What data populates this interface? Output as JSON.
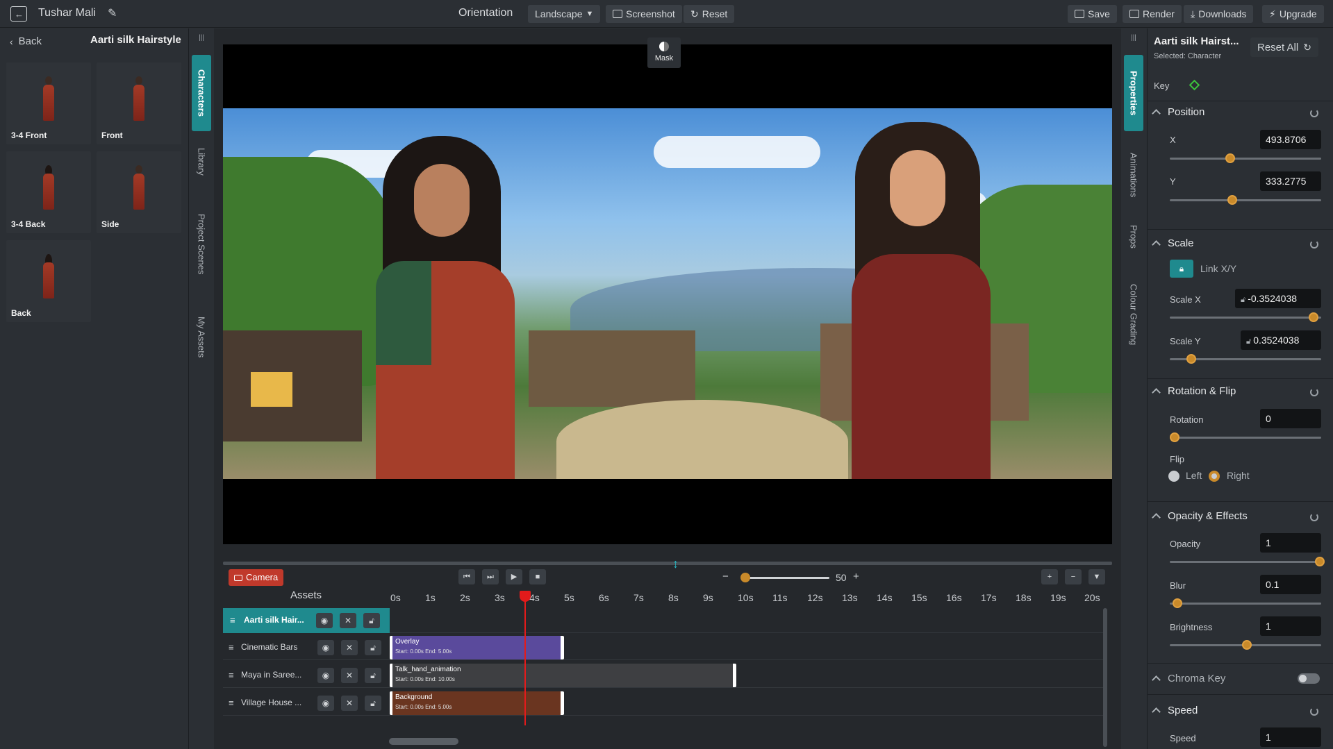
{
  "topbar": {
    "user_name": "Tushar Mali",
    "orientation_label": "Orientation",
    "orientation_value": "Landscape",
    "screenshot_label": "Screenshot",
    "reset_label": "Reset",
    "save_label": "Save",
    "render_label": "Render",
    "downloads_label": "Downloads",
    "upgrade_label": "Upgrade"
  },
  "leftpanel": {
    "back_label": "Back",
    "title": "Aarti silk Hairstyle",
    "thumbnails": [
      "3-4 Front",
      "Front",
      "3-4 Back",
      "Side",
      "Back"
    ]
  },
  "lefttabs": [
    "Characters",
    "Library",
    "Project Scenes",
    "My Assets"
  ],
  "righttabs": [
    "Properties",
    "Animations",
    "Props",
    "Colour Grading"
  ],
  "canvas": {
    "mask_label": "Mask"
  },
  "timeline": {
    "camera_label": "Camera",
    "assets_label": "Assets",
    "zoom_value": "50",
    "ticks": [
      "0s",
      "1s",
      "2s",
      "3s",
      "4s",
      "5s",
      "6s",
      "7s",
      "8s",
      "9s",
      "10s",
      "11s",
      "12s",
      "13s",
      "14s",
      "15s",
      "16s",
      "17s",
      "18s",
      "19s",
      "20s"
    ],
    "tracks": [
      {
        "name": "Aarti silk Hair...",
        "selected": true
      },
      {
        "name": "Cinematic Bars",
        "clip_title": "Overlay",
        "clip_sub": "Start: 0.00s   End: 5.00s"
      },
      {
        "name": "Maya in Saree...",
        "clip_title": "Talk_hand_animation",
        "clip_sub": "Start: 0.00s   End: 10.00s"
      },
      {
        "name": "Village House ...",
        "clip_title": "Background",
        "clip_sub": "Start: 0.00s   End: 5.00s"
      }
    ]
  },
  "properties": {
    "title": "Aarti silk Hairst...",
    "subtitle": "Selected: Character",
    "reset_all_label": "Reset All",
    "key_label": "Key",
    "position": {
      "header": "Position",
      "x_label": "X",
      "x_value": "493.8706",
      "y_label": "Y",
      "y_value": "333.2775"
    },
    "scale": {
      "header": "Scale",
      "link_label": "Link X/Y",
      "sx_label": "Scale X",
      "sx_value": "-0.3524038",
      "sy_label": "Scale Y",
      "sy_value": "0.3524038"
    },
    "rotation": {
      "header": "Rotation & Flip",
      "rotation_label": "Rotation",
      "rotation_value": "0",
      "flip_label": "Flip",
      "left_label": "Left",
      "right_label": "Right"
    },
    "effects": {
      "header": "Opacity & Effects",
      "opacity_label": "Opacity",
      "opacity_value": "1",
      "blur_label": "Blur",
      "blur_value": "0.1",
      "brightness_label": "Brightness",
      "brightness_value": "1"
    },
    "chroma": {
      "header": "Chroma Key"
    },
    "speed": {
      "header": "Speed",
      "speed_label": "Speed",
      "speed_value": "1"
    }
  },
  "colors": {
    "accent_teal": "#1f8a8e",
    "playhead_red": "#e31b1b",
    "knob_orange": "#c98a2a"
  }
}
